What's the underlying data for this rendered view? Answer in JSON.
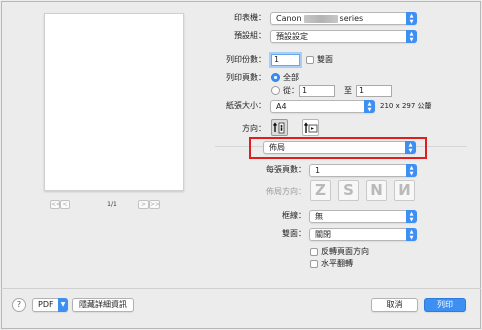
{
  "preview": {
    "page_indicator": "1/1",
    "nav_first": "<<",
    "nav_prev": "<",
    "nav_next": ">",
    "nav_last": ">>"
  },
  "printer": {
    "label": "印表機：",
    "value_prefix": "Canon",
    "value_suffix": "series"
  },
  "preset": {
    "label": "預設組：",
    "value": "預設設定"
  },
  "copies": {
    "label": "列印份數：",
    "value": "1",
    "duplex_label": "雙面"
  },
  "pages": {
    "label": "列印頁數：",
    "all_label": "全部",
    "from_label": "從：",
    "from_value": "1",
    "to_label": "至",
    "to_value": "1"
  },
  "paper_size": {
    "label": "紙張大小：",
    "value": "A4",
    "dimensions": "210 x 297 公釐"
  },
  "orientation": {
    "label": "方向："
  },
  "section": {
    "value": "佈局"
  },
  "pages_per_sheet": {
    "label": "每張頁數：",
    "value": "1"
  },
  "layout_direction": {
    "label": "佈局方向：",
    "options": [
      "Z",
      "S",
      "N",
      "N"
    ]
  },
  "border": {
    "label": "框線：",
    "value": "無"
  },
  "two_sided": {
    "label": "雙面：",
    "value": "關閉"
  },
  "reverse_orientation": {
    "label": "反轉頁面方向"
  },
  "flip_horizontal": {
    "label": "水平翻轉"
  },
  "footer": {
    "help": "?",
    "pdf": "PDF",
    "hide_details": "隱藏詳細資訊",
    "cancel": "取消",
    "print": "列印"
  },
  "colors": {
    "accent": "#3e8ff2",
    "highlight_box": "#e01e1e"
  }
}
